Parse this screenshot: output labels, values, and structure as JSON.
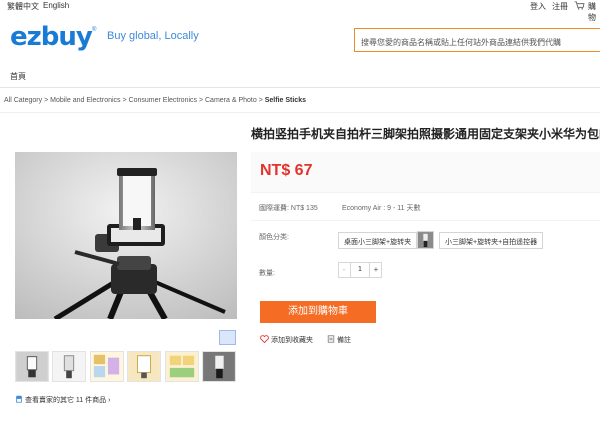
{
  "topbar": {
    "lang_traditional": "繁體中文",
    "lang_english": "English",
    "login": "登入",
    "register": "注冊",
    "cart": "購物"
  },
  "header": {
    "logo": "ezbuy",
    "logo_mark": "®",
    "slogan": "Buy global, Locally",
    "search_placeholder": "搜尋您愛的商品名稱或貼上任何站外商品連結供我們代購"
  },
  "nav": {
    "home": "首頁"
  },
  "breadcrumb": {
    "items": [
      "All Category",
      "Mobile and Electronics",
      "Consumer Electronics",
      "Camera & Photo"
    ],
    "separator": " > ",
    "current": "Selfie Sticks"
  },
  "product": {
    "title": "横拍竖拍手机夹自拍杆三脚架拍照摄影通用固定支架夹小米华为包邮",
    "price": "NT$ 67",
    "shipping_intl": "國際運費: NT$ 135",
    "shipping_method": "Economy Air : 9 - 11 天數",
    "color_label": "顏色分类:",
    "options": [
      "桌面小三脚架+旋转夹",
      "小三脚架+旋转夹+自拍遥控器"
    ],
    "qty_label": "數量:",
    "qty_minus": "-",
    "qty_value": "1",
    "qty_plus": "+",
    "add_to_cart": "添加到購物車",
    "favorite": "添加到收藏夹",
    "note": "備註",
    "store_link": "查看賣家的其它 11 件商品"
  },
  "colors": {
    "brand_blue": "#1a7bd7",
    "accent_orange": "#f56c25",
    "price_red": "#e3332d"
  },
  "icons": [
    "cart-icon",
    "heart-icon",
    "note-icon",
    "store-icon",
    "chevron-right-icon"
  ]
}
